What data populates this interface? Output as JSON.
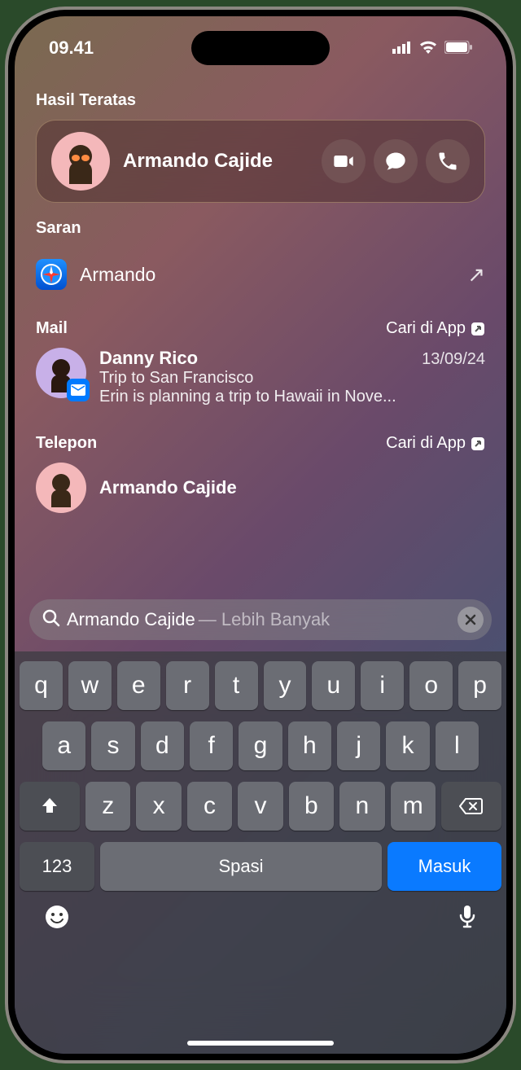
{
  "status": {
    "time": "09.41"
  },
  "sections": {
    "top_hits_label": "Hasil Teratas",
    "suggestions_label": "Saran",
    "mail_label": "Mail",
    "telepon_label": "Telepon",
    "search_in_app": "Cari di App"
  },
  "top_hit": {
    "name": "Armando Cajide"
  },
  "suggestion": {
    "text": "Armando"
  },
  "mail": {
    "sender": "Danny Rico",
    "date": "13/09/24",
    "subject": "Trip to San Francisco",
    "preview": "Erin is planning a trip to Hawaii in Nove..."
  },
  "telepon": {
    "name": "Armando Cajide"
  },
  "search": {
    "query": "Armando Cajide",
    "more_hint": " —  Lebih Banyak"
  },
  "keyboard": {
    "row1": [
      "q",
      "w",
      "e",
      "r",
      "t",
      "y",
      "u",
      "i",
      "o",
      "p"
    ],
    "row2": [
      "a",
      "s",
      "d",
      "f",
      "g",
      "h",
      "j",
      "k",
      "l"
    ],
    "row3": [
      "z",
      "x",
      "c",
      "v",
      "b",
      "n",
      "m"
    ],
    "numbers_label": "123",
    "space_label": "Spasi",
    "return_label": "Masuk"
  }
}
